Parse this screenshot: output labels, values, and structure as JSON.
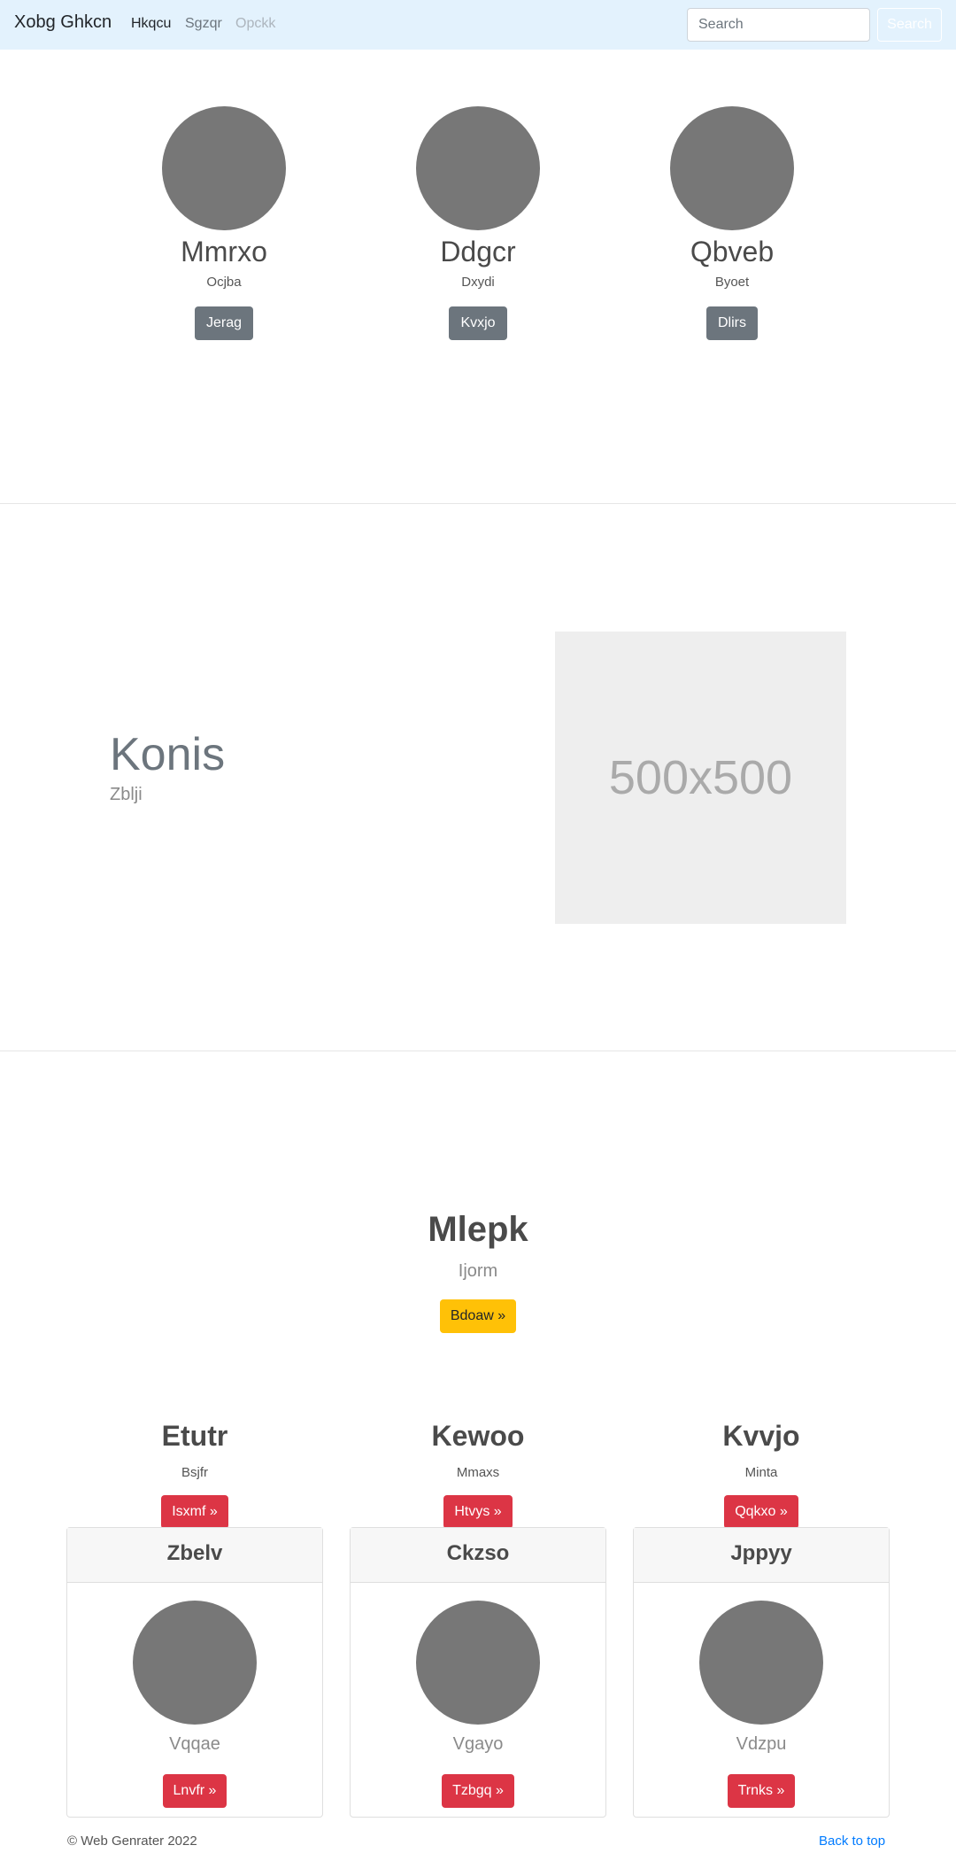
{
  "navbar": {
    "brand": "Xobg Ghkcn",
    "links": [
      "Hkqcu",
      "Sgzqr",
      "Opckk"
    ],
    "search_placeholder": "Search",
    "search_button": "Search"
  },
  "people": [
    {
      "name": "Mmrxo",
      "sub": "Ocjba",
      "button": "Jerag"
    },
    {
      "name": "Ddgcr",
      "sub": "Dxydi",
      "button": "Kvxjo"
    },
    {
      "name": "Qbveb",
      "sub": "Byoet",
      "button": "Dlirs"
    }
  ],
  "feature": {
    "title": "Konis",
    "subtitle": "Zblji",
    "image_label": "500x500"
  },
  "hero": {
    "title": "Mlepk",
    "subtitle": "Ijorm",
    "button": "Bdoaw »"
  },
  "columns": [
    {
      "title": "Etutr",
      "sub": "Bsjfr",
      "button": "Isxmf »"
    },
    {
      "title": "Kewoo",
      "sub": "Mmaxs",
      "button": "Htvys »"
    },
    {
      "title": "Kvvjo",
      "sub": "Minta",
      "button": "Qqkxo »"
    }
  ],
  "cards": [
    {
      "header": "Zbelv",
      "sub": "Vqqae",
      "button": "Lnvfr »"
    },
    {
      "header": "Ckzso",
      "sub": "Vgayo",
      "button": "Tzbgq »"
    },
    {
      "header": "Jppyy",
      "sub": "Vdzpu",
      "button": "Trnks »"
    }
  ],
  "footer": {
    "copyright": "© Web Genrater 2022",
    "back_to_top": "Back to top"
  }
}
